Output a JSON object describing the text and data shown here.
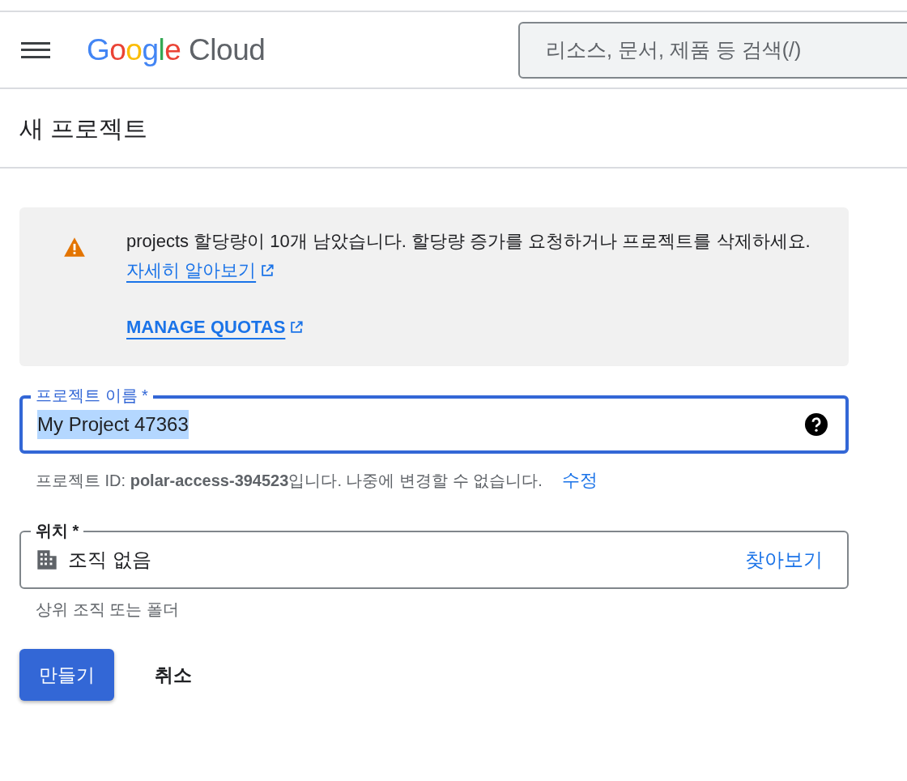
{
  "header": {
    "logo": {
      "brand": "Google",
      "product": "Cloud"
    },
    "search": {
      "placeholder": "리소스, 문서, 제품 등 검색(/)"
    }
  },
  "page_title": "새 프로젝트",
  "alert": {
    "message": "projects 할당량이 10개 남았습니다. 할당량 증가를 요청하거나 프로젝트를 삭제하세요.",
    "link": "자세히 알아보기",
    "action": "MANAGE QUOTAS"
  },
  "project_name": {
    "label": "프로젝트 이름 *",
    "value": "My Project 47363",
    "focused": true,
    "text_selected": true,
    "hint": "프로젝트 ID: **polar-access-394523**입니다. 나중에 변경할 수 없습니다.",
    "hint_action": "수정"
  },
  "location": {
    "label": "위치 *",
    "value": "조직 없음",
    "action": "찾아보기",
    "hint": "상위 조직 또는 폴더"
  },
  "buttons": [
    {
      "kind": "primary",
      "label": "만들기"
    },
    {
      "kind": "text",
      "label": "취소"
    }
  ]
}
